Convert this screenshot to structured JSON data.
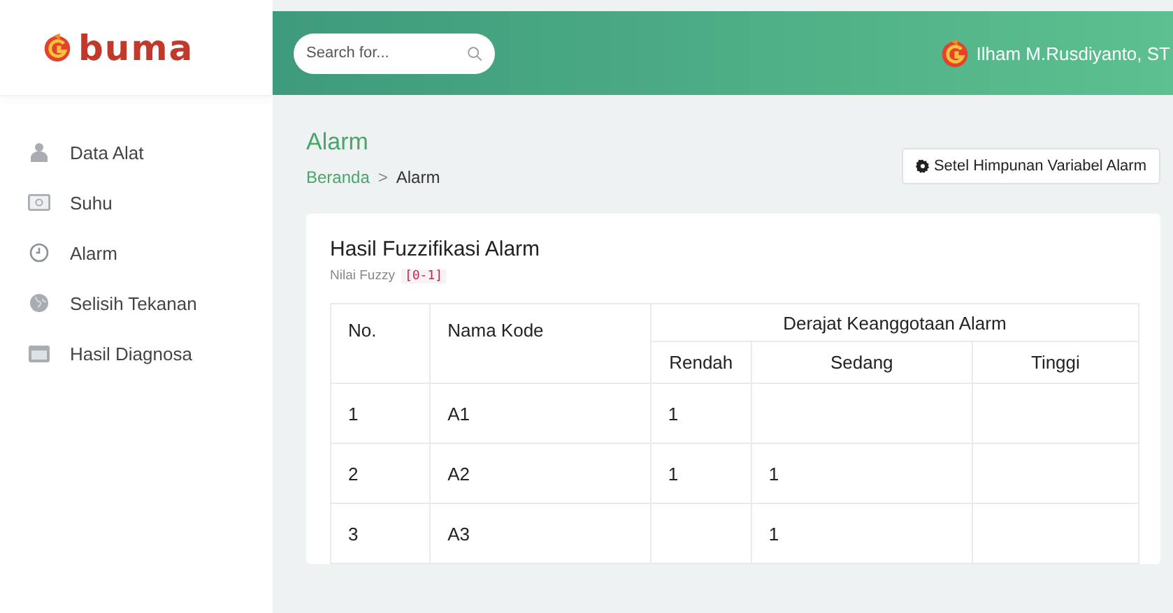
{
  "logo": {
    "text": "buma"
  },
  "search": {
    "placeholder": "Search for..."
  },
  "user": {
    "name": "Ilham M.Rusdiyanto, ST"
  },
  "sidebar": {
    "items": [
      {
        "label": "Data Alat"
      },
      {
        "label": "Suhu"
      },
      {
        "label": "Alarm"
      },
      {
        "label": "Selisih Tekanan"
      },
      {
        "label": "Hasil Diagnosa"
      }
    ]
  },
  "page": {
    "title": "Alarm",
    "breadcrumb": [
      "Beranda",
      "Alarm"
    ],
    "separator": ">",
    "button": "Setel Himpunan Variabel Alarm"
  },
  "card": {
    "title": "Hasil Fuzzifikasi Alarm",
    "subtitle": "Nilai Fuzzy",
    "code": "[0-1]"
  },
  "table": {
    "columns": [
      "No.",
      "Nama Kode"
    ],
    "group": "Derajat Keanggotaan Alarm",
    "subcolumns": [
      "Rendah",
      "Sedang",
      "Tinggi"
    ],
    "rows": [
      [
        "1",
        "A1",
        "1",
        "",
        ""
      ],
      [
        "2",
        "A2",
        "1",
        "1",
        ""
      ],
      [
        "3",
        "A3",
        "",
        "1",
        ""
      ]
    ]
  }
}
